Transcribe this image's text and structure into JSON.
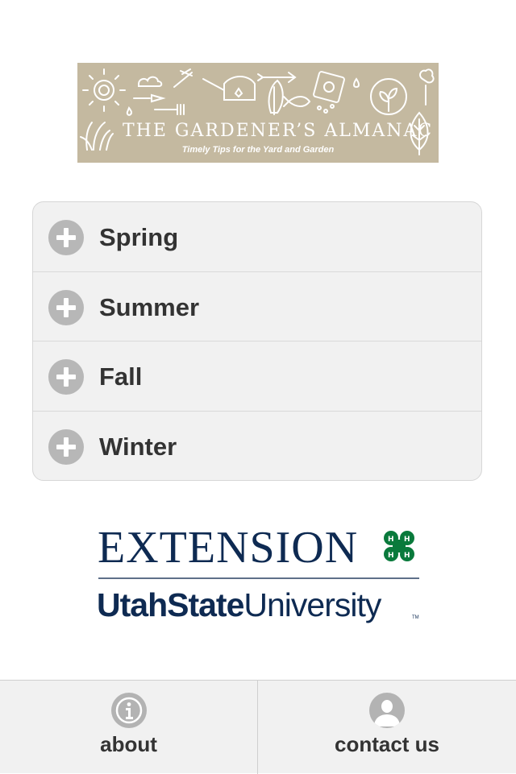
{
  "banner": {
    "title": "THE GARDENER’S ALMANAC",
    "subtitle": "Timely Tips for the Yard and Garden",
    "background_color": "#c4b9a0"
  },
  "seasons": [
    {
      "label": "Spring",
      "icon": "plus-icon"
    },
    {
      "label": "Summer",
      "icon": "plus-icon"
    },
    {
      "label": "Fall",
      "icon": "plus-icon"
    },
    {
      "label": "Winter",
      "icon": "plus-icon"
    }
  ],
  "logo": {
    "extension": "EXTENSION",
    "university_bold": "UtahState",
    "university_regular": "University",
    "trademark": "TM",
    "brand_color": "#0e2a52",
    "clover_color": "#0a7a3c"
  },
  "footer": {
    "about_label": "about",
    "about_icon": "info-icon",
    "contact_label": "contact us",
    "contact_icon": "person-icon"
  }
}
